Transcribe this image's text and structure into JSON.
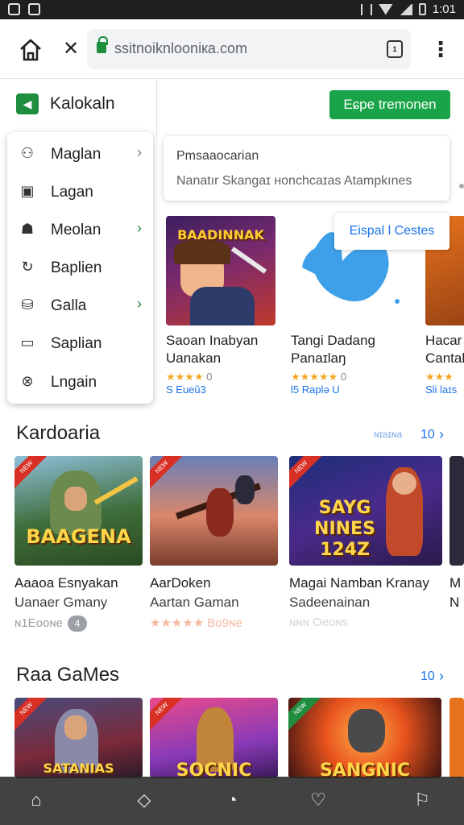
{
  "browser": {
    "url": "ssitnoiknlooniкa.com",
    "tabs_count": "1"
  },
  "header": {
    "brand": "Kalokaln",
    "cta": "Eɕpe tremonen"
  },
  "menu": [
    {
      "label": "Maglan",
      "icon": "person-icon",
      "chevron": "grey"
    },
    {
      "label": "Lagan",
      "icon": "calendar-icon",
      "chevron": ""
    },
    {
      "label": "Meolan",
      "icon": "group-icon",
      "chevron": "green"
    },
    {
      "label": "Baplien",
      "icon": "refresh-icon",
      "chevron": ""
    },
    {
      "label": "Galla",
      "icon": "bag-icon",
      "chevron": "green"
    },
    {
      "label": "Saplian",
      "icon": "card-icon",
      "chevron": ""
    },
    {
      "label": "Lngain",
      "icon": "cancel-icon",
      "chevron": ""
    }
  ],
  "search": {
    "title": "Pmsaaocarian",
    "subtitle": "Nanatır  Skangaɪ  ʜonchcaɪas   Atampkınes"
  },
  "tooltip": "Eispal l Cestes",
  "featured": [
    {
      "art": "BAADINNAK",
      "name1": "Saoan Inabyan",
      "name2": "Uanakan",
      "stars": "★★★★",
      "count": "0",
      "sub": "S Eueŭ3"
    },
    {
      "art": "",
      "name1": "Tangi Dadang",
      "name2": "Panaɪlaŋ",
      "stars": "★★★★★",
      "count": "0",
      "sub": "l5 Raplǝ U"
    },
    {
      "art": "",
      "name1": "Hacar",
      "name2": "Cantal",
      "stars": "★★★",
      "count": "",
      "sub": "Sli laɪs"
    }
  ],
  "section1": {
    "title": "Kardoaria",
    "more_label": "ɴɪaɪɴa",
    "more_count": "10"
  },
  "games1": [
    {
      "art": "BAAGENA",
      "title1": "Aaaoa Esnyakan",
      "title2": "Uanaer Gmany",
      "meta": "ɴ1Eooɴe",
      "badge": "4"
    },
    {
      "art": "",
      "title1": "AarDoken",
      "title2": "Aartan Gaman",
      "meta": "★★★★★  Bo9ɴe",
      "badge": ""
    },
    {
      "art": "SAYG NINES 124Z",
      "title1": "Magai Namban Kranay",
      "title2": "Sadeenainan",
      "meta": "ɴɴɴ  Oeoɴs",
      "badge": ""
    },
    {
      "art": "",
      "title1": "M",
      "title2": "N",
      "meta": "",
      "badge": ""
    }
  ],
  "section2": {
    "title": "Raa GaMes",
    "more_count": "10"
  },
  "games2": [
    {
      "art": "SATANIAS"
    },
    {
      "art": "SOCNIC"
    },
    {
      "art": "SANGNIC"
    }
  ],
  "bottom_nav": [
    "home-icon",
    "box-icon",
    "bell-icon",
    "heart-icon",
    "flag-icon"
  ]
}
